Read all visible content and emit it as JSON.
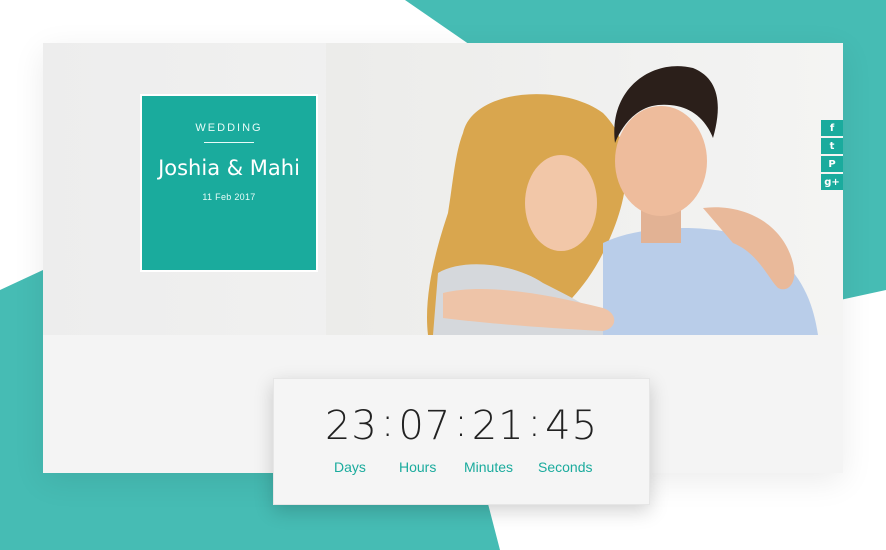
{
  "colors": {
    "accent": "#1aab9d",
    "bg_teal": "#47bcb4"
  },
  "hero": {
    "kicker": "WEDDING",
    "names": "Joshia & Mahi",
    "date": "11 Feb 2017"
  },
  "social": [
    {
      "icon": "facebook-icon",
      "glyph": "f"
    },
    {
      "icon": "twitter-icon",
      "glyph": "t"
    },
    {
      "icon": "pinterest-icon",
      "glyph": "P"
    },
    {
      "icon": "google-plus-icon",
      "glyph": "g+"
    }
  ],
  "countdown": {
    "days": "23",
    "hours": "07",
    "minutes": "21",
    "seconds": "45",
    "separator": ":",
    "labels": {
      "days": "Days",
      "hours": "Hours",
      "minutes": "Minutes",
      "seconds": "Seconds"
    }
  }
}
